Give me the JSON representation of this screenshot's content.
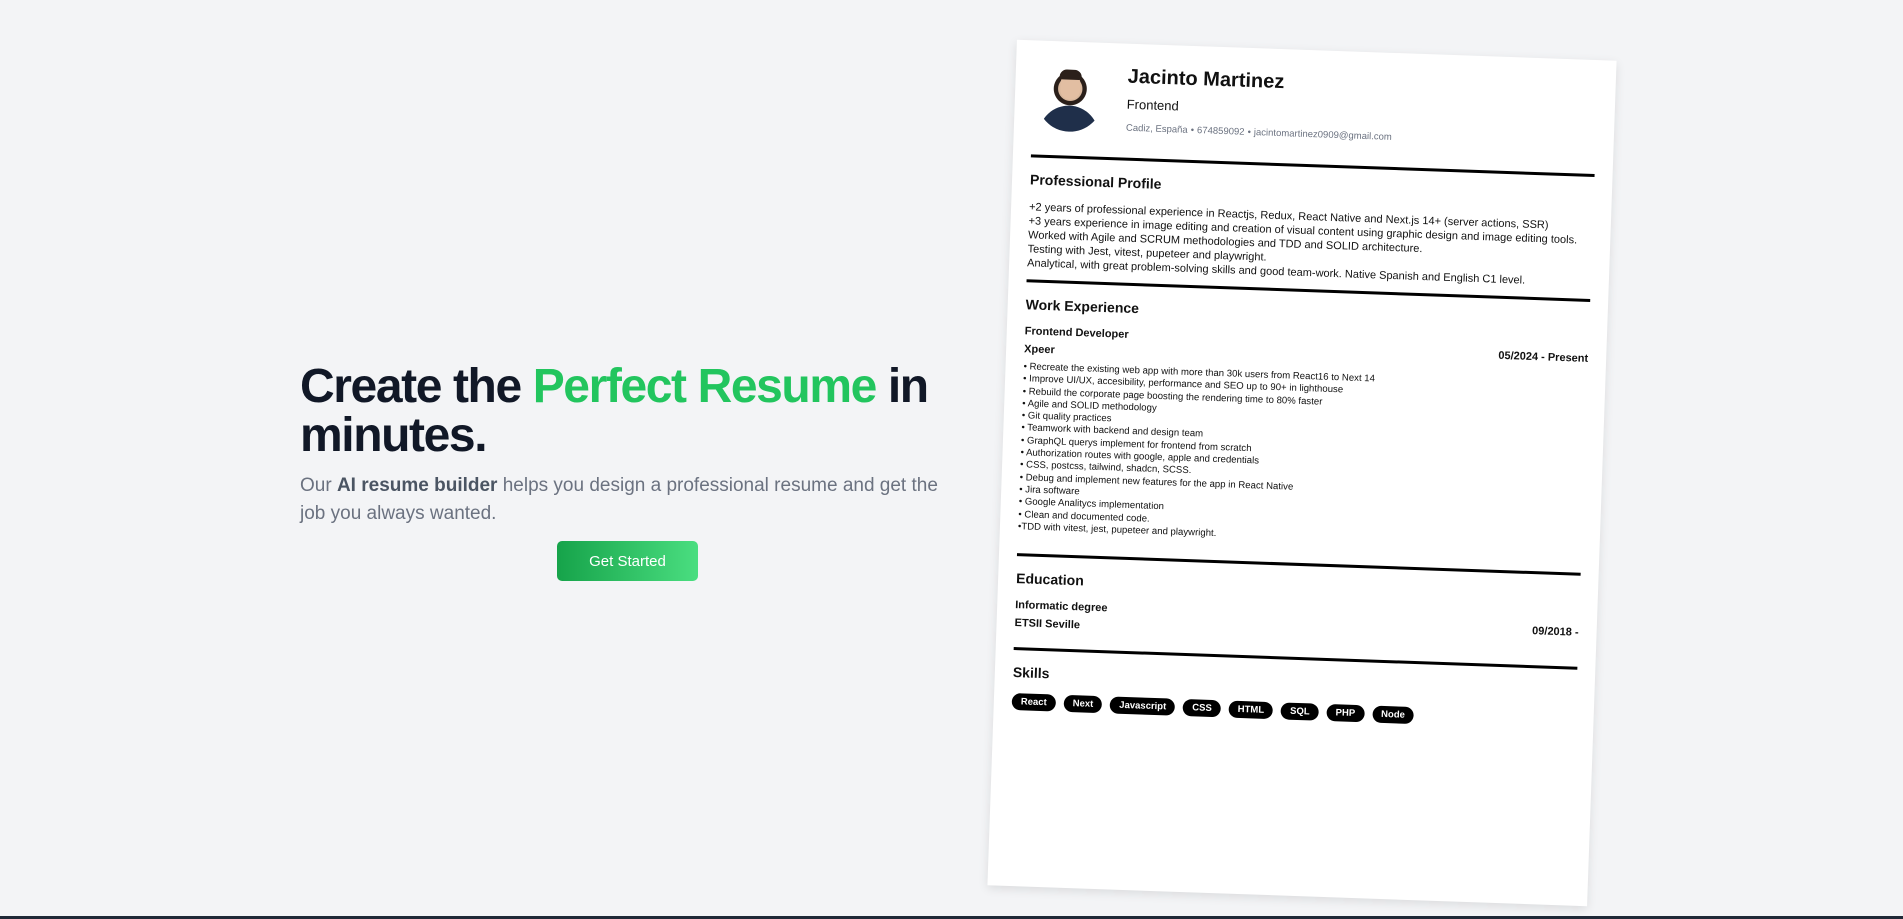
{
  "hero": {
    "title_part1": "Create the ",
    "title_accent": "Perfect Resume",
    "title_part2": " in minutes.",
    "sub_prefix": "Our ",
    "sub_bold": "AI resume builder",
    "sub_suffix": " helps you design a professional resume and get the job you always wanted.",
    "cta_label": "Get Started",
    "accent_color": "#22c55e"
  },
  "resume": {
    "name": "Jacinto Martinez",
    "role": "Frontend",
    "location": "Cadiz, España",
    "phone": "674859092",
    "email": "jacintomartinez0909@gmail.com",
    "contact_sep": "•",
    "profile": {
      "title": "Professional Profile",
      "lines": [
        "+2 years of professional experience in Reactjs, Redux, React Native and Next.js 14+ (server actions, SSR)",
        "+3 years experience in image editing and creation of visual content using graphic design and image editing tools.",
        "Worked with Agile and SCRUM methodologies and TDD and SOLID architecture.",
        "Testing with Jest, vitest, pupeteer and playwright.",
        "Analytical, with great problem-solving skills and good team-work. Native Spanish and English C1 level."
      ]
    },
    "work": {
      "title": "Work Experience",
      "job_title": "Frontend Developer",
      "company": "Xpeer",
      "date": "05/2024 - Present",
      "bullets": [
        "• Recreate the existing web app with more than 30k users from React16 to Next 14",
        "• Improve UI/UX, accesibility, performance and SEO up to 90+ in lighthouse",
        "• Rebuild the corporate page boosting the rendering time to 80% faster",
        "• Agile and SOLID methodology",
        "• Git quality practices",
        "• Teamwork with backend and design team",
        "• GraphQL querys implement for frontend from scratch",
        "• Authorization routes with google, apple and credentials",
        "• CSS, postcss, tailwind, shadcn, SCSS.",
        "• Debug and implement new features for the app in React Native",
        "• Jira software",
        "• Google Analitycs implementation",
        "• Clean and documented code.",
        "•TDD with vitest, jest, pupeteer and playwright."
      ]
    },
    "education": {
      "title": "Education",
      "degree": "Informatic degree",
      "school": "ETSII Seville",
      "date": "09/2018 -"
    },
    "skills": {
      "title": "Skills",
      "items": [
        "React",
        "Next",
        "Javascript",
        "CSS",
        "HTML",
        "SQL",
        "PHP",
        "Node"
      ]
    }
  }
}
